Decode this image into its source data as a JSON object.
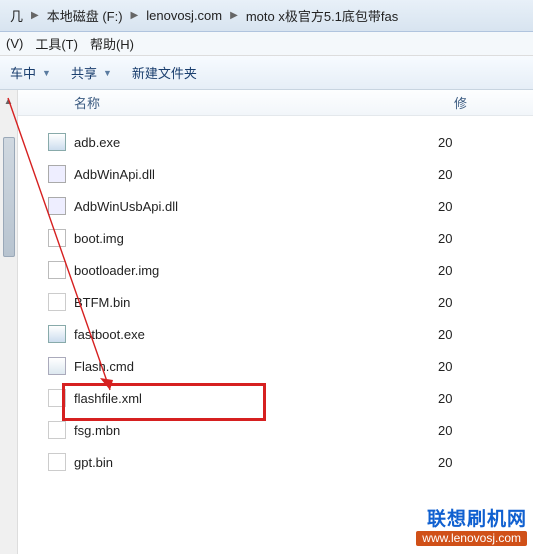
{
  "breadcrumbs": [
    "几",
    "本地磁盘 (F:)",
    "lenovosj.com",
    "moto x极官方5.1底包带fas"
  ],
  "menu": {
    "view": "(V)",
    "tools": "工具(T)",
    "help": "帮助(H)"
  },
  "toolbar": {
    "include": "车中",
    "share": "共享",
    "newfolder": "新建文件夹"
  },
  "columns": {
    "name": "名称",
    "date": "修"
  },
  "files": [
    {
      "name": "adb.exe",
      "date": "20",
      "icon": "exe"
    },
    {
      "name": "AdbWinApi.dll",
      "date": "20",
      "icon": "dll"
    },
    {
      "name": "AdbWinUsbApi.dll",
      "date": "20",
      "icon": "dll"
    },
    {
      "name": "boot.img",
      "date": "20",
      "icon": "img"
    },
    {
      "name": "bootloader.img",
      "date": "20",
      "icon": "img"
    },
    {
      "name": "BTFM.bin",
      "date": "20",
      "icon": "bin"
    },
    {
      "name": "fastboot.exe",
      "date": "20",
      "icon": "exe"
    },
    {
      "name": "Flash.cmd",
      "date": "20",
      "icon": "cmd"
    },
    {
      "name": "flashfile.xml",
      "date": "20",
      "icon": "xml"
    },
    {
      "name": "fsg.mbn",
      "date": "20",
      "icon": "bin"
    },
    {
      "name": "gpt.bin",
      "date": "20",
      "icon": "bin"
    }
  ],
  "watermark": {
    "title": "联想刷机网",
    "url": "www.lenovosj.com"
  }
}
